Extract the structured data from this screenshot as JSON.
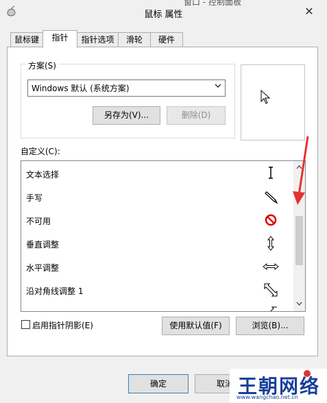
{
  "window": {
    "behind_title": "窗口 - 控制面板",
    "title": "鼠标 属性",
    "close_glyph": "✕",
    "app_icon": "mouse-icon"
  },
  "tabs": [
    {
      "label": "鼠标键",
      "active": false
    },
    {
      "label": "指针",
      "active": true
    },
    {
      "label": "指针选项",
      "active": false
    },
    {
      "label": "滑轮",
      "active": false
    },
    {
      "label": "硬件",
      "active": false
    }
  ],
  "scheme": {
    "label": "方案(S)",
    "selected": "Windows 默认 (系统方案)",
    "save_as_label": "另存为(V)...",
    "delete_label": "删除(D)"
  },
  "customize": {
    "label": "自定义(C):",
    "items": [
      {
        "label": "文本选择",
        "icon": "text-select-icon"
      },
      {
        "label": "手写",
        "icon": "pen-icon"
      },
      {
        "label": "不可用",
        "icon": "unavailable-icon"
      },
      {
        "label": "垂直调整",
        "icon": "vertical-resize-icon"
      },
      {
        "label": "水平调整",
        "icon": "horizontal-resize-icon"
      },
      {
        "label": "沿对角线调整 1",
        "icon": "diagonal-resize-icon"
      }
    ]
  },
  "pointer_shadow": {
    "label": "启用指针阴影(E)",
    "checked": false
  },
  "buttons": {
    "use_default": "使用默认值(F)",
    "browse": "浏览(B)...",
    "ok": "确定",
    "cancel": "取消"
  },
  "watermark": {
    "text": "王朝网络",
    "url": "www.wangchao.net.cn"
  },
  "colors": {
    "annotation_arrow": "#e8312f",
    "watermark": "#1a3f9a"
  }
}
